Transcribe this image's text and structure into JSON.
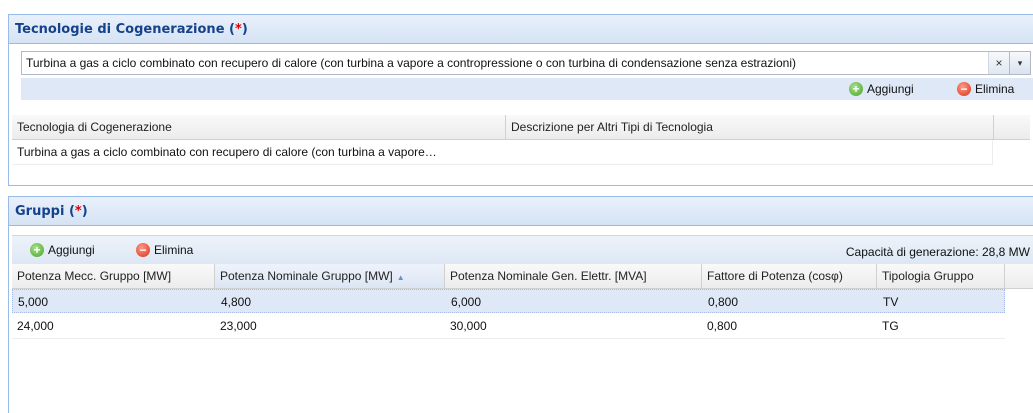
{
  "tech_panel": {
    "title": "Tecnologie di Cogenerazione",
    "required_open": "(",
    "required_star": "*",
    "required_close": ")",
    "combo_value": "Turbina a gas a ciclo combinato con recupero di calore (con turbina a vapore a contropressione o con turbina di condensazione senza estrazioni)",
    "combo_clear": "×",
    "combo_trigger": "▾",
    "add_label": "Aggiungi",
    "delete_label": "Elimina",
    "columns": [
      "Tecnologia di Cogenerazione",
      "Descrizione per Altri Tipi di Tecnologia"
    ],
    "rows": [
      [
        "Turbina a gas a ciclo combinato con recupero di calore (con turbina a vapore…",
        ""
      ]
    ]
  },
  "groups_panel": {
    "title": "Gruppi",
    "required_open": "(",
    "required_star": "*",
    "required_close": ")",
    "add_label": "Aggiungi",
    "delete_label": "Elimina",
    "capacity_text": "Capacità di generazione: 28,8 MW",
    "columns": [
      "Potenza Mecc. Gruppo [MW]",
      "Potenza Nominale Gruppo [MW]",
      "Potenza Nominale Gen. Elettr. [MVA]",
      "Fattore di Potenza (cosφ)",
      "Tipologia Gruppo"
    ],
    "sort_indicator": "▲",
    "rows": [
      [
        "5,000",
        "4,800",
        "6,000",
        "0,800",
        "TV"
      ],
      [
        "24,000",
        "23,000",
        "30,000",
        "0,800",
        "TG"
      ]
    ]
  },
  "colors": {
    "panel_border": "#99bbe8",
    "title_text": "#15428b",
    "required_marker": "#e00000",
    "selected_row": "#dfe8f6"
  },
  "icons": {
    "add": "add-circle-icon",
    "delete": "delete-circle-icon"
  }
}
